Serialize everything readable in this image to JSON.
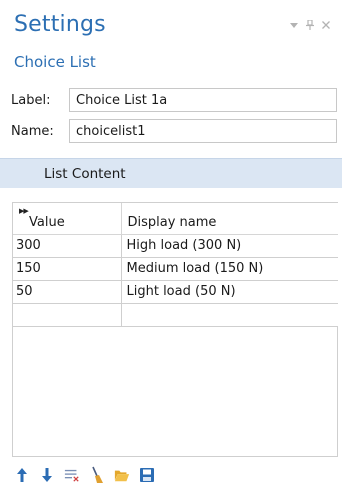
{
  "panel": {
    "title": "Settings",
    "subtitle": "Choice List"
  },
  "fields": {
    "label_caption": "Label:",
    "label_value": "Choice List 1a",
    "name_caption": "Name:",
    "name_value": "choicelist1"
  },
  "section": {
    "title": "List Content"
  },
  "table": {
    "columns": [
      "Value",
      "Display name"
    ],
    "rows": [
      [
        "300",
        "High load (300 N)"
      ],
      [
        "150",
        "Medium load (150 N)"
      ],
      [
        "50",
        "Light load (50 N)"
      ],
      [
        "",
        ""
      ]
    ]
  },
  "toolbar": {
    "icons": [
      "arrow-up-icon",
      "arrow-down-icon",
      "clear-list-icon",
      "brush-icon",
      "open-folder-icon",
      "save-icon"
    ]
  },
  "colors": {
    "accent": "#2c6fb3",
    "section_bg": "#dbe6f3"
  }
}
